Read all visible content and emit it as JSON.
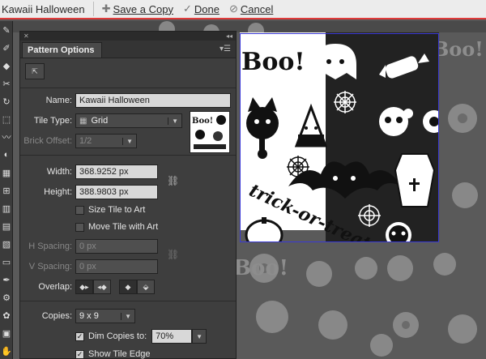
{
  "topbar": {
    "pattern_name": "Kawaii Halloween",
    "save_copy_label": "Save a Copy",
    "done_label": "Done",
    "cancel_label": "Cancel"
  },
  "panel": {
    "title": "Pattern Options",
    "name_label": "Name:",
    "name_value": "Kawaii Halloween",
    "tile_type_label": "Tile Type:",
    "tile_type_value": "Grid",
    "brick_offset_label": "Brick Offset:",
    "brick_offset_value": "1/2",
    "width_label": "Width:",
    "width_value": "368.9252 px",
    "height_label": "Height:",
    "height_value": "388.9803 px",
    "size_tile_label": "Size Tile to Art",
    "move_tile_label": "Move Tile with Art",
    "h_spacing_label": "H Spacing:",
    "h_spacing_value": "0 px",
    "v_spacing_label": "V Spacing:",
    "v_spacing_value": "0 px",
    "overlap_label": "Overlap:",
    "copies_label": "Copies:",
    "copies_value": "9 x 9",
    "dim_copies_label": "Dim Copies to:",
    "dim_copies_value": "70%",
    "show_tile_edge_label": "Show Tile Edge",
    "size_tile_checked": false,
    "move_tile_checked": false,
    "dim_copies_checked": true,
    "show_tile_edge_checked": true
  },
  "artwork": {
    "boo_text": "Boo!",
    "trick_text": "trick-or-treat"
  },
  "colors": {
    "accent_line": "#e03a3a",
    "tile_bound": "#3a39d6"
  }
}
